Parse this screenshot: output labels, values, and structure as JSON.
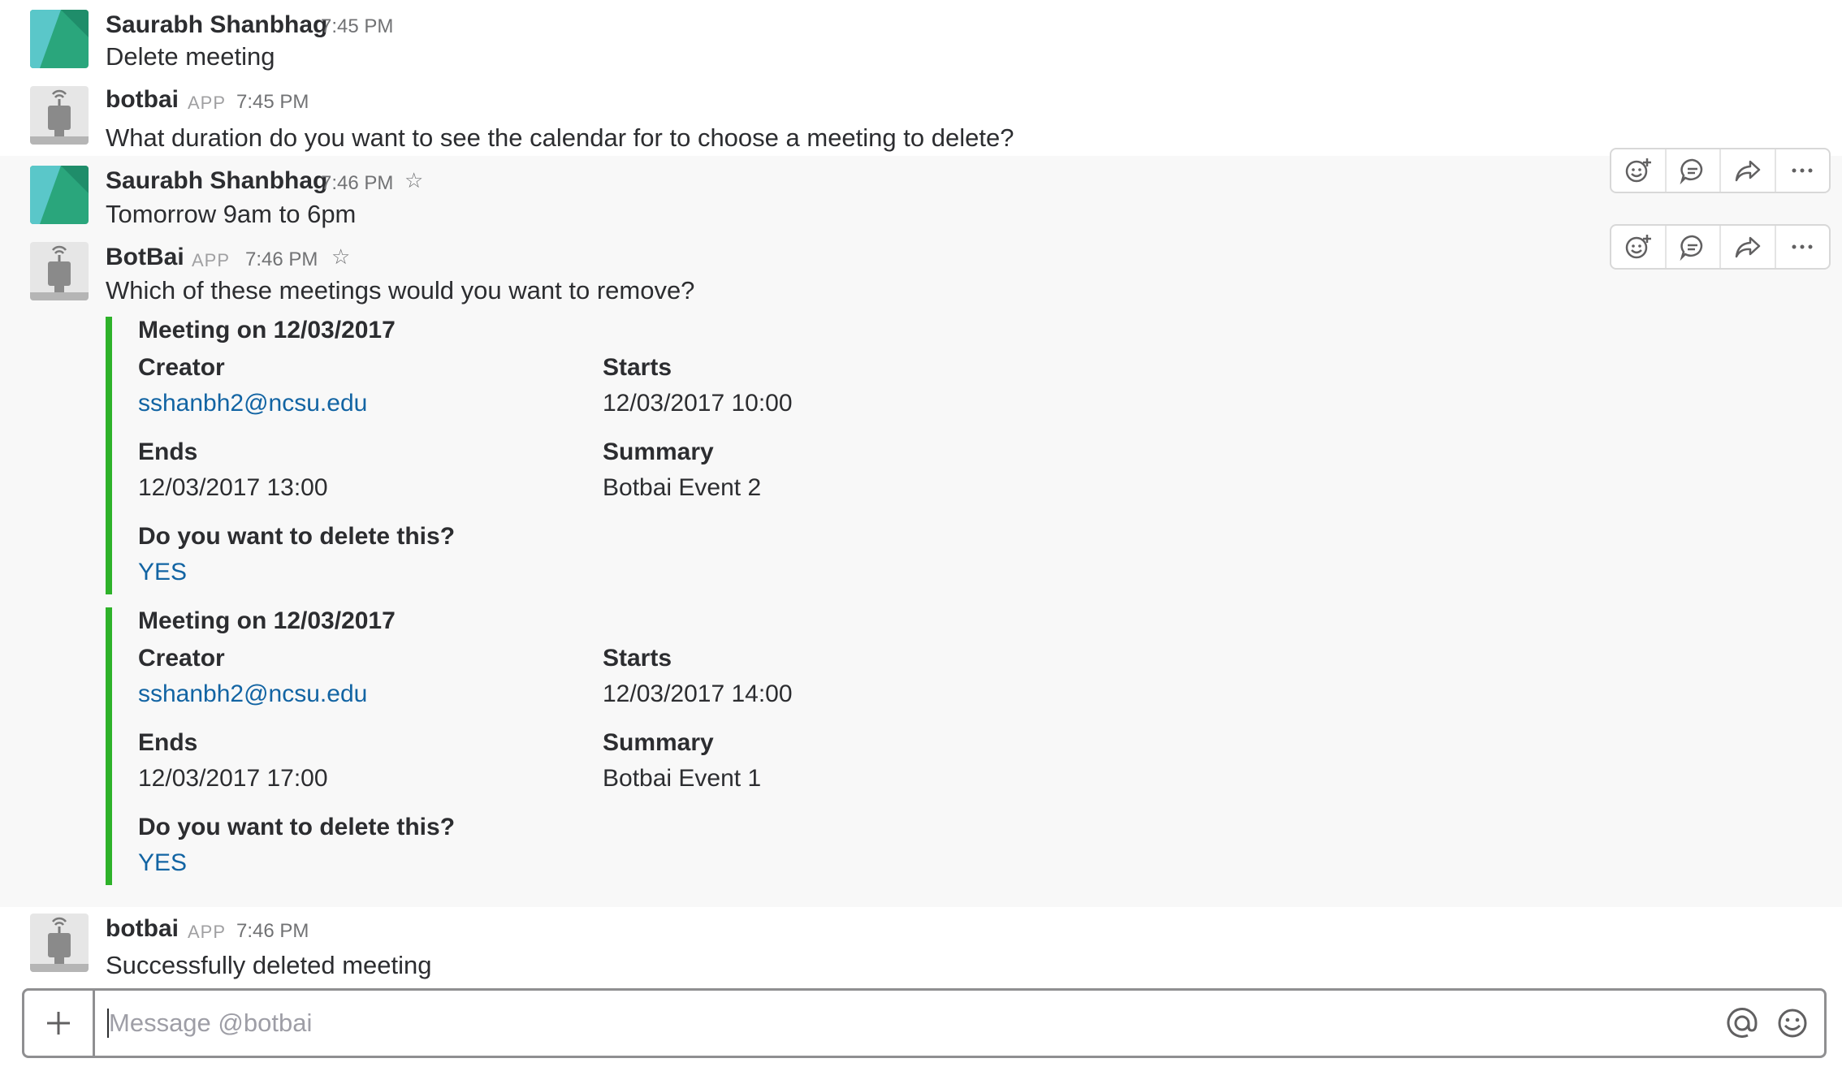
{
  "messages": [
    {
      "name": "Saurabh Shanbhag",
      "time": "7:45 PM",
      "text": "Delete meeting"
    },
    {
      "name": "botbai",
      "app": "APP",
      "time": "7:45 PM",
      "text": "What duration do you want to see the calendar for to choose a meeting to delete?"
    },
    {
      "name": "Saurabh Shanbhag",
      "time": "7:46 PM",
      "text": "Tomorrow 9am to 6pm"
    },
    {
      "name": "BotBai",
      "app": "APP",
      "time": "7:46 PM",
      "text": "Which of these meetings would you want to remove?"
    },
    {
      "name": "botbai",
      "app": "APP",
      "time": "7:46 PM",
      "text": "Successfully deleted meeting"
    }
  ],
  "attachments": [
    {
      "title": "Meeting on 12/03/2017",
      "creator_label": "Creator",
      "creator": "sshanbh2@ncsu.edu",
      "starts_label": "Starts",
      "starts": "12/03/2017 10:00",
      "ends_label": "Ends",
      "ends": "12/03/2017 13:00",
      "summary_label": "Summary",
      "summary": "Botbai Event 2",
      "question": "Do you want to delete this?",
      "action": "YES"
    },
    {
      "title": "Meeting on 12/03/2017",
      "creator_label": "Creator",
      "creator": "sshanbh2@ncsu.edu",
      "starts_label": "Starts",
      "starts": "12/03/2017 14:00",
      "ends_label": "Ends",
      "ends": "12/03/2017 17:00",
      "summary_label": "Summary",
      "summary": "Botbai Event 1",
      "question": "Do you want to delete this?",
      "action": "YES"
    }
  ],
  "message_actions": [
    "add-reaction-icon",
    "start-thread-icon",
    "share-message-icon",
    "more-actions-icon"
  ],
  "composer": {
    "placeholder": "Message @botbai"
  },
  "icons": {
    "star": "☆"
  },
  "colors": {
    "accent_bar": "#2eb22a",
    "link": "#1264a3",
    "highlight_bg": "#f8f8f8"
  }
}
